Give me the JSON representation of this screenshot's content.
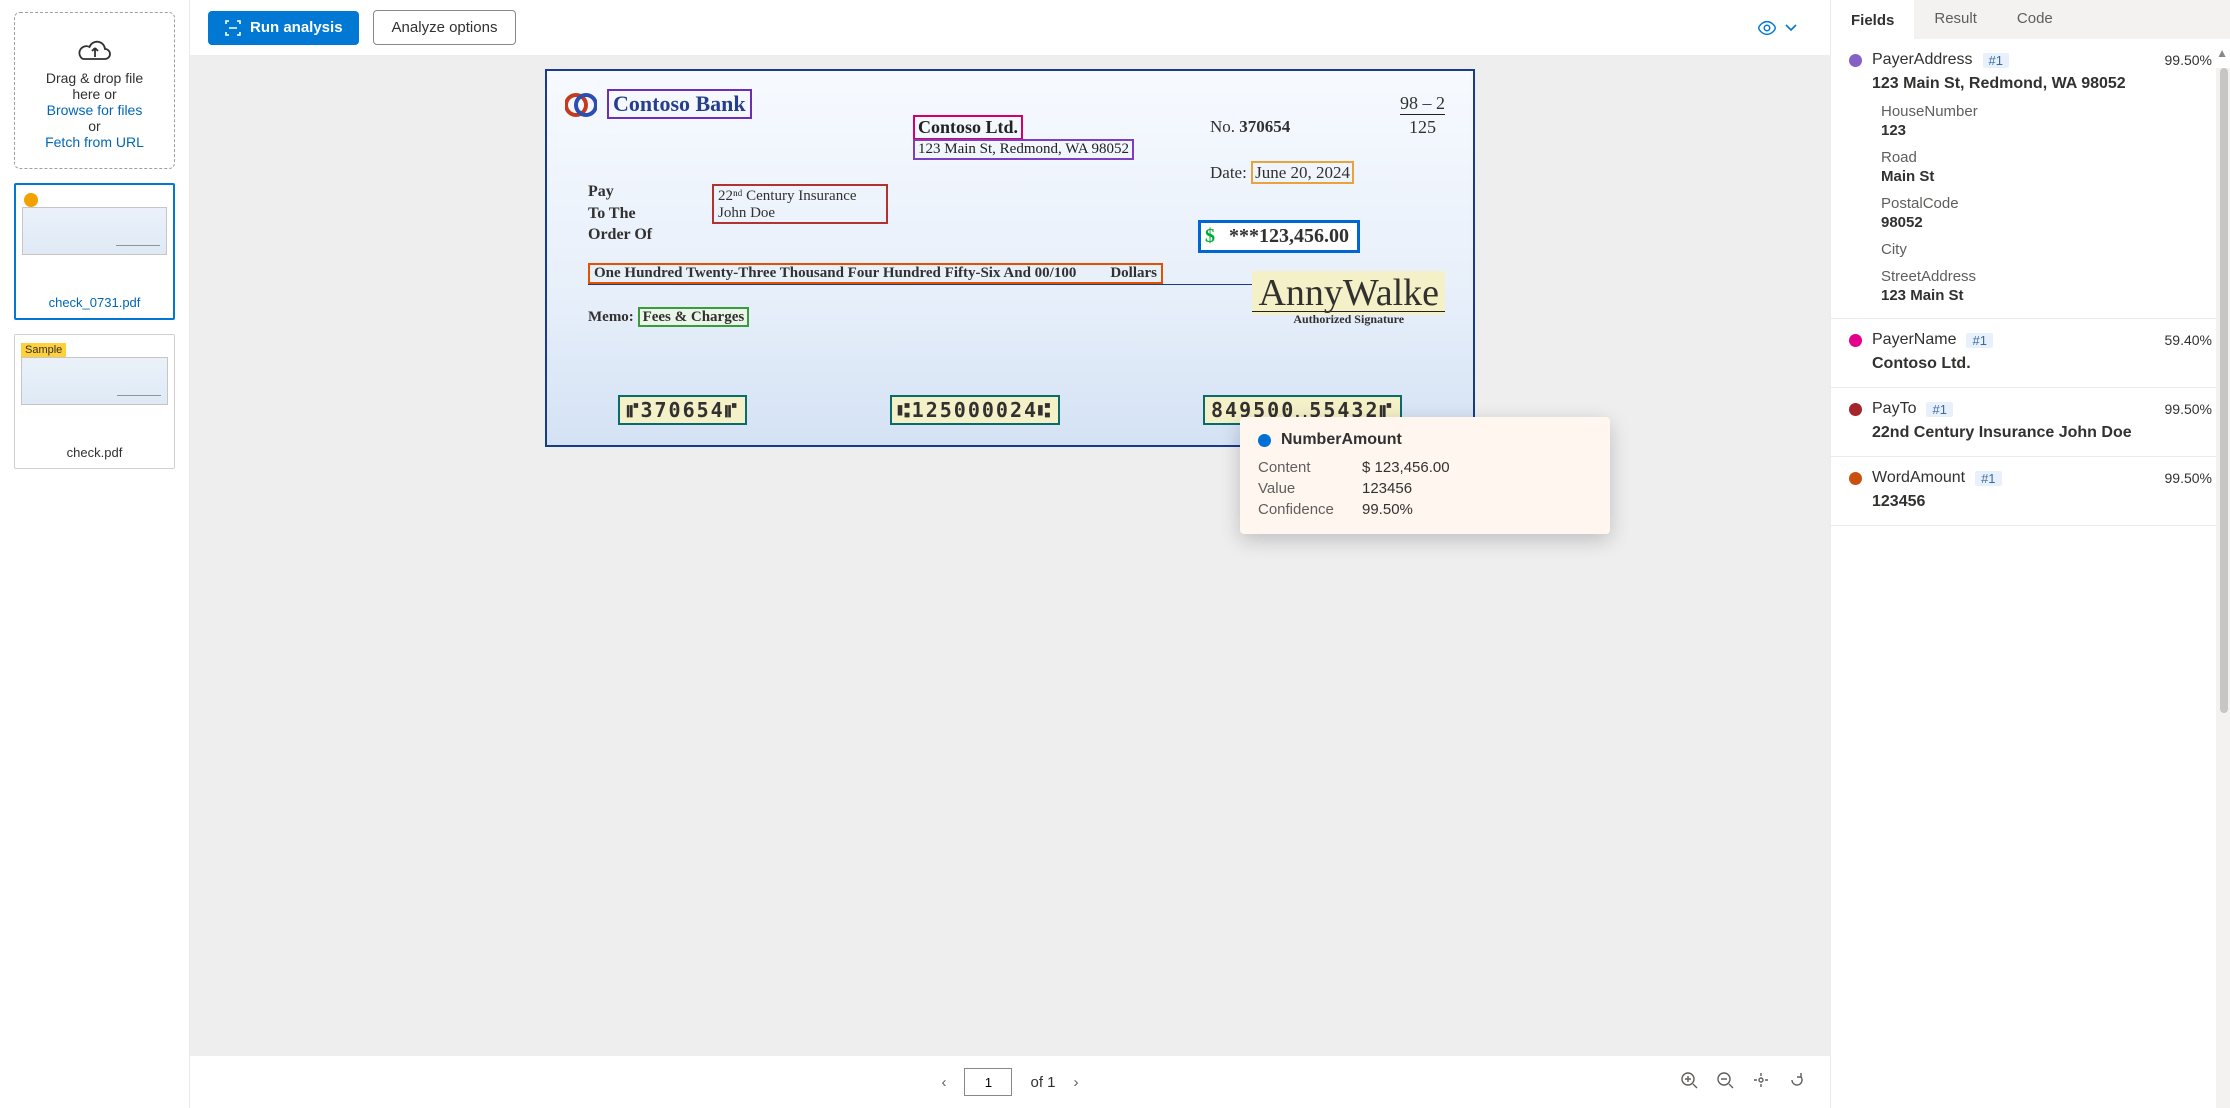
{
  "sidebar": {
    "drop_line1": "Drag & drop file",
    "drop_line2": "here or",
    "browse": "Browse for files",
    "or": "or",
    "fetch": "Fetch from URL",
    "thumbs": [
      {
        "name": "check_0731.pdf",
        "selected": true,
        "dot": true
      },
      {
        "name": "check.pdf",
        "sample_label": "Sample"
      }
    ]
  },
  "toolbar": {
    "run": "Run analysis",
    "options": "Analyze options"
  },
  "check": {
    "bank": "Contoso Bank",
    "payer_name": "Contoso Ltd.",
    "payer_addr": "123 Main St, Redmond, WA 98052",
    "no_label": "No.",
    "no": "370654",
    "routing_top": "98 – 2",
    "routing_bot": "125",
    "date_label": "Date:",
    "date": "June 20, 2024",
    "payto_label_1": "Pay",
    "payto_label_2": "To The",
    "payto_label_3": "Order Of",
    "payto_line1": "22ⁿᵈ Century Insurance",
    "payto_line2": "John Doe",
    "amount_sym": "$",
    "amount": "***123,456.00",
    "words": "One Hundred Twenty-Three Thousand Four Hundred Fifty-Six And 00/100",
    "dollars": "Dollars",
    "memo_label": "Memo:",
    "memo": "Fees & Charges",
    "signature": "AnnyWalke",
    "sig_label": "Authorized Signature",
    "micr1": "⑈370654⑈",
    "micr2": "⑆125000024⑆",
    "micr3": "849500␣55432⑈"
  },
  "tooltip": {
    "title": "NumberAmount",
    "rows": [
      {
        "k": "Content",
        "v": "$ 123,456.00"
      },
      {
        "k": "Value",
        "v": "123456"
      },
      {
        "k": "Confidence",
        "v": "99.50%"
      }
    ]
  },
  "footer": {
    "page": "1",
    "of": "of 1"
  },
  "panel": {
    "tabs": [
      "Fields",
      "Result",
      "Code"
    ],
    "fields": [
      {
        "color": "#8661c5",
        "name": "PayerAddress",
        "badge": "#1",
        "conf": "99.50%",
        "value": "123 Main St, Redmond, WA 98052",
        "subs": [
          {
            "k": "HouseNumber",
            "v": "123"
          },
          {
            "k": "Road",
            "v": "Main St"
          },
          {
            "k": "PostalCode",
            "v": "98052"
          },
          {
            "k": "City",
            "v": ""
          },
          {
            "k": "StreetAddress",
            "v": "123 Main St"
          }
        ]
      },
      {
        "color": "#e3008c",
        "name": "PayerName",
        "badge": "#1",
        "conf": "59.40%",
        "value": "Contoso Ltd."
      },
      {
        "color": "#a4262c",
        "name": "PayTo",
        "badge": "#1",
        "conf": "99.50%",
        "value": "22nd Century Insurance John Doe"
      },
      {
        "color": "#ca5010",
        "name": "WordAmount",
        "badge": "#1",
        "conf": "99.50%",
        "value": "123456"
      }
    ]
  }
}
